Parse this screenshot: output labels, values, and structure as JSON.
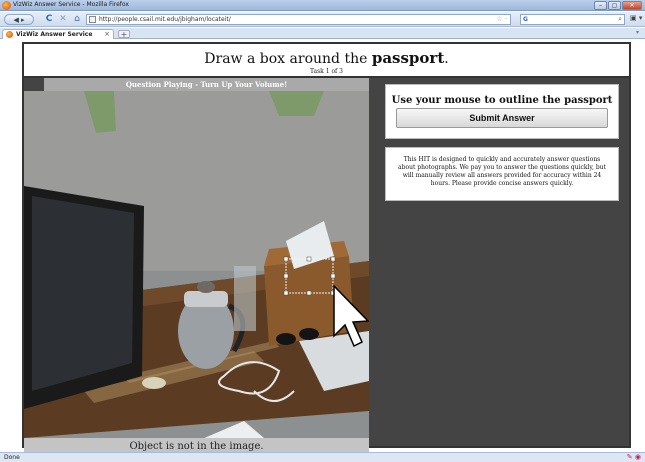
{
  "window": {
    "title": "VizWiz Answer Service - Mozilla Firefox",
    "controls": {
      "minimize": "–",
      "maximize": "▢",
      "close": "✕"
    }
  },
  "nav": {
    "back": "◀ ▸",
    "reload": "C",
    "stop": "✕",
    "home": "⌂",
    "url": "http://people.csail.mit.edu/jbigham/locateit/",
    "bookmark_star": "☆ ·",
    "search_engine": "G",
    "search_icon": "⌕",
    "menu_icon": "▣ ▾"
  },
  "tabs": {
    "active_label": "VizWiz Answer Service",
    "close": "×",
    "new_tab": "+",
    "scroll_arrow": "▾"
  },
  "page": {
    "instruction_prefix": "Draw a box around the ",
    "target_object": "passport",
    "instruction_suffix": ".",
    "task_counter": "Task 1 of 3",
    "status_banner": "Question Playing - Turn Up Your Volume!",
    "not_in_image": "Object is not in the image.",
    "outline_heading": "Use your mouse to outline the passport",
    "submit_label": "Submit Answer",
    "info_text": "This HIT is designed to quickly and accurately answer questions about photographs. We pay you to answer the questions quickly, but will manually review all answers provided for accuracy within 24 hours. Please provide concise answers quickly."
  },
  "statusbar": {
    "text": "Done",
    "addon_icons": "✎ ◉"
  }
}
